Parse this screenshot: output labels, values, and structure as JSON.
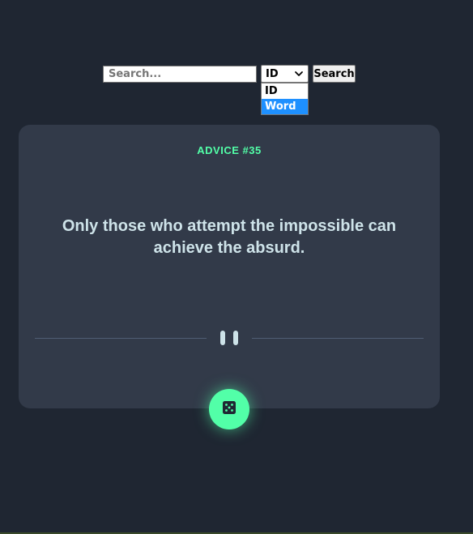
{
  "search": {
    "placeholder": "Search...",
    "value": "",
    "button_label": "Search"
  },
  "filter": {
    "selected": "ID",
    "options": [
      "ID",
      "Word"
    ],
    "highlighted": "Word"
  },
  "advice": {
    "id_label": "ADVICE #35",
    "text": "Only those who attempt the impossible can achieve the absurd."
  },
  "icons": {
    "pause": "pause-icon",
    "dice": "dice-icon",
    "dropdown": "chevron-down-icon"
  },
  "colors": {
    "background": "#1f2632",
    "card": "#323a49",
    "accent": "#52ffa8",
    "text": "#cee3e9",
    "divider": "#4f5d74",
    "option_highlight": "#1e90ff"
  }
}
